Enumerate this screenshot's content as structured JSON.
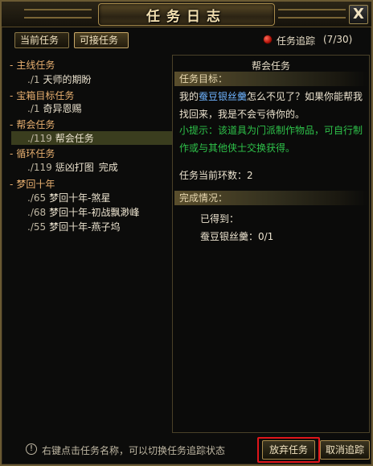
{
  "window": {
    "title": "任务日志",
    "close_label": "X"
  },
  "tabs": [
    {
      "label": "当前任务",
      "active": false
    },
    {
      "label": "可接任务",
      "active": true
    }
  ],
  "tracking": {
    "label": "任务追踪",
    "count": "(7/30)"
  },
  "categories": [
    {
      "label": "主线任务",
      "quests": [
        {
          "level": "./1",
          "name": "天师的期盼"
        }
      ]
    },
    {
      "label": "宝箱目标任务",
      "quests": [
        {
          "level": "./1",
          "name": "奇异恩赐"
        }
      ]
    },
    {
      "label": "帮会任务",
      "quests": [
        {
          "level": "./119",
          "name": "帮会任务",
          "selected": true
        }
      ]
    },
    {
      "label": "循环任务",
      "quests": [
        {
          "level": "./119",
          "name": "惩凶打图",
          "status": "完成"
        }
      ]
    },
    {
      "label": "梦回十年",
      "quests": [
        {
          "level": "./65",
          "name": "梦回十年-煞星"
        },
        {
          "level": "./68",
          "name": "梦回十年-初战飘渺峰"
        },
        {
          "level": "./55",
          "name": "梦回十年-燕子坞"
        }
      ]
    }
  ],
  "detail": {
    "title": "帮会任务",
    "goal_header": "任务目标：",
    "goal_pre": "我的",
    "goal_item": "蚕豆银丝羹",
    "goal_post": "怎么不见了？如果你能帮我找回来，我是不会亏待你的。",
    "hint": "小提示：该道具为门派制作物品，可自行制作或与其他侠士交换获得。",
    "rounds": "任务当前环数：2",
    "status_header": "完成情况：",
    "obtained_label": "已得到：",
    "progress": "蚕豆银丝羹：0/1"
  },
  "footer": {
    "hint": "右键点击任务名称，可以切换任务追踪状态",
    "abandon_label": "放弃任务",
    "untrack_label": "取消追踪"
  },
  "colors": {
    "category": "#e8b070",
    "hint": "#2ec24a",
    "item": "#6fb4ff",
    "highlight": "#e0151a"
  }
}
